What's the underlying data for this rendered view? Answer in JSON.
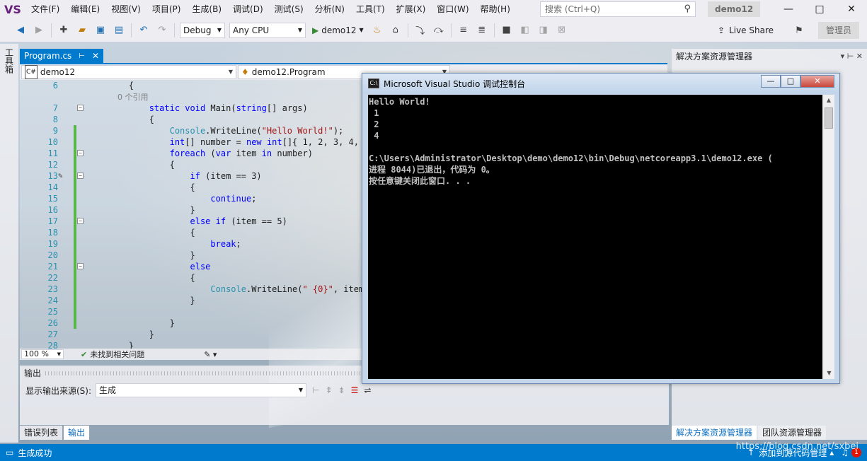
{
  "menu": {
    "logo": "VS",
    "items": [
      "文件(F)",
      "编辑(E)",
      "视图(V)",
      "项目(P)",
      "生成(B)",
      "调试(D)",
      "测试(S)",
      "分析(N)",
      "工具(T)",
      "扩展(X)",
      "窗口(W)",
      "帮助(H)"
    ],
    "search_placeholder": "搜索 (Ctrl+Q)",
    "solution_name": "demo12",
    "window_controls": [
      "—",
      "□",
      "✕"
    ]
  },
  "toolbar": {
    "config": "Debug",
    "platform": "Any CPU",
    "run_target": "demo12",
    "live_share": "Live Share",
    "admin": "管理员"
  },
  "toolbox": {
    "label": "工具箱"
  },
  "editor": {
    "tab_title": "Program.cs",
    "tab_pin": "⊢",
    "tab_close": "✕",
    "nav_project": "demo12",
    "nav_class": "demo12.Program",
    "zoom": "100 %",
    "status": "未找到相关问题"
  },
  "code_lines": [
    {
      "n": "6",
      "text": "        {"
    },
    {
      "n": "",
      "text": "            0 个引用",
      "comment": true
    },
    {
      "n": "7",
      "text": "            static void Main(string[] args)"
    },
    {
      "n": "8",
      "text": "            {"
    },
    {
      "n": "9",
      "text": "                Console.WriteLine(\"Hello World!\");"
    },
    {
      "n": "10",
      "text": "                int[] number = new int[]{ 1, 2, 3, 4, 5 };"
    },
    {
      "n": "11",
      "text": "                foreach (var item in number)"
    },
    {
      "n": "12",
      "text": "                {"
    },
    {
      "n": "13",
      "text": "                    if (item == 3)"
    },
    {
      "n": "14",
      "text": "                    {"
    },
    {
      "n": "15",
      "text": "                        continue;"
    },
    {
      "n": "16",
      "text": "                    }"
    },
    {
      "n": "17",
      "text": "                    else if (item == 5)"
    },
    {
      "n": "18",
      "text": "                    {"
    },
    {
      "n": "19",
      "text": "                        break;"
    },
    {
      "n": "20",
      "text": "                    }"
    },
    {
      "n": "21",
      "text": "                    else"
    },
    {
      "n": "22",
      "text": "                    {"
    },
    {
      "n": "23",
      "text": "                        Console.WriteLine(\" {0}\", item);"
    },
    {
      "n": "24",
      "text": "                    }"
    },
    {
      "n": "25",
      "text": ""
    },
    {
      "n": "26",
      "text": "                }"
    },
    {
      "n": "27",
      "text": "            }"
    },
    {
      "n": "28",
      "text": "        }"
    }
  ],
  "output": {
    "title": "输出",
    "source_label": "显示输出来源(S):",
    "source_value": "生成"
  },
  "bottom_tabs": [
    "错误列表",
    "输出"
  ],
  "solution_explorer": {
    "title": "解决方案资源管理器",
    "tabs": [
      "解决方案资源管理器",
      "团队资源管理器"
    ]
  },
  "console": {
    "title": "Microsoft Visual Studio 调试控制台",
    "lines": [
      "Hello World!",
      " 1",
      " 2",
      " 4",
      "",
      "C:\\Users\\Administrator\\Desktop\\demo\\demo12\\bin\\Debug\\netcoreapp3.1\\demo12.exe (",
      "进程 8044)已退出，代码为 0。",
      "按任意键关闭此窗口. . ."
    ]
  },
  "statusbar": {
    "left": "生成成功",
    "right": "添加到源代码管理",
    "badge": "1"
  },
  "watermark": "https://blog.csdn.net/sxbei"
}
